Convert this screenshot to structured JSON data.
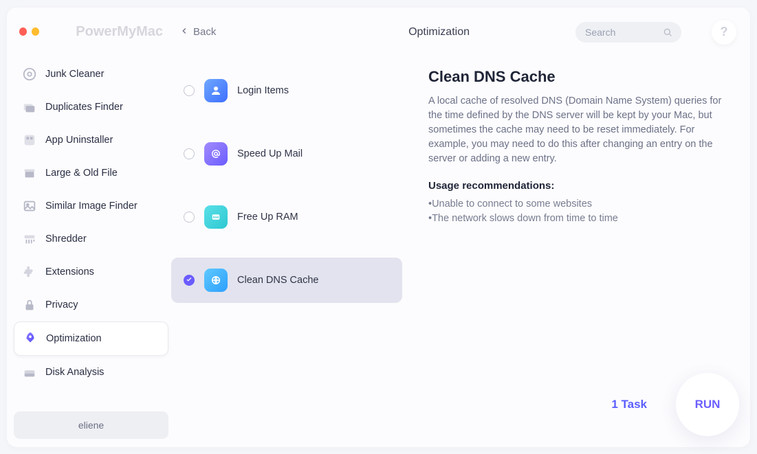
{
  "app_title": "PowerMyMac",
  "back_label": "Back",
  "search_placeholder": "Search",
  "help_label": "?",
  "crumb": "Optimization",
  "user_name": "eliene",
  "sidebar": {
    "items": [
      {
        "label": "Junk Cleaner",
        "icon": "junk"
      },
      {
        "label": "Duplicates Finder",
        "icon": "duplicates"
      },
      {
        "label": "App Uninstaller",
        "icon": "uninstall"
      },
      {
        "label": "Large & Old File",
        "icon": "large-old"
      },
      {
        "label": "Similar Image Finder",
        "icon": "image"
      },
      {
        "label": "Shredder",
        "icon": "shredder"
      },
      {
        "label": "Extensions",
        "icon": "extensions"
      },
      {
        "label": "Privacy",
        "icon": "privacy"
      },
      {
        "label": "Optimization",
        "icon": "optimization"
      },
      {
        "label": "Disk Analysis",
        "icon": "disk"
      }
    ]
  },
  "options": [
    {
      "label": "Login Items",
      "icon": "user",
      "icon_class": "grad-blue",
      "selected": false
    },
    {
      "label": "Speed Up Mail",
      "icon": "at",
      "icon_class": "grad-purple",
      "selected": false
    },
    {
      "label": "Free Up RAM",
      "icon": "ram",
      "icon_class": "grad-teal",
      "selected": false
    },
    {
      "label": "Clean DNS Cache",
      "icon": "dns",
      "icon_class": "grad-sky",
      "selected": true
    }
  ],
  "detail": {
    "title": "Clean DNS Cache",
    "description": "A local cache of resolved DNS (Domain Name System) queries for the time defined by the DNS server will be kept by your Mac, but sometimes the cache may need to be reset immediately. For example, you may need to do this after changing an entry on the server or adding a new entry.",
    "recs_title": "Usage recommendations:",
    "recs": [
      "Unable to connect to some websites",
      "The network slows down from time to time"
    ]
  },
  "footer": {
    "task_count_label": "1 Task",
    "run_label": "RUN"
  }
}
